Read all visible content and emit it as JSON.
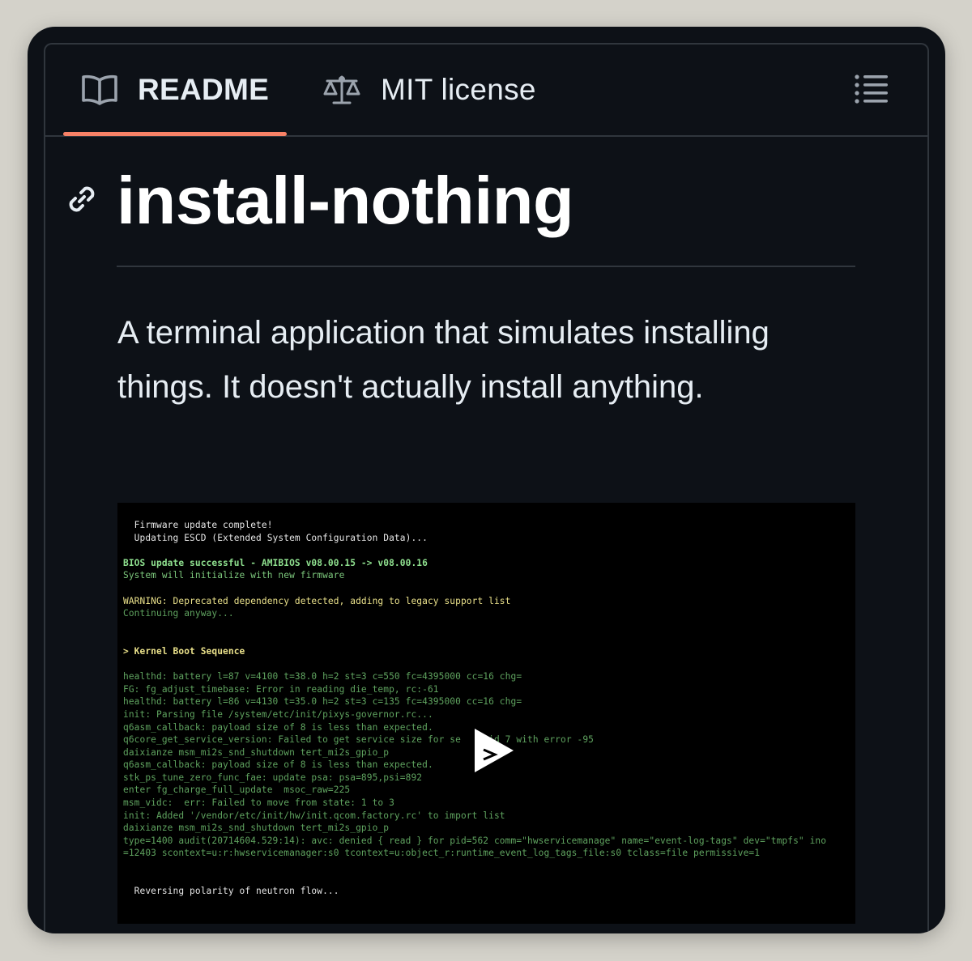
{
  "tabs": [
    {
      "label": "README",
      "icon": "book-icon",
      "active": true
    },
    {
      "label": "MIT license",
      "icon": "law-scale-icon",
      "active": false
    }
  ],
  "outline_icon": "list-unordered-icon",
  "heading": {
    "text": "install-nothing",
    "anchor_icon": "link-icon"
  },
  "description": "A terminal application that simulates installing things. It doesn't actually install anything.",
  "video": {
    "play_icon": "play-icon",
    "lines": [
      {
        "text": "  Firmware update complete!",
        "style": "white"
      },
      {
        "text": "  Updating ESCD (Extended System Configuration Data)...",
        "style": "white"
      },
      {
        "text": "",
        "style": "white"
      },
      {
        "text": "BIOS update successful - AMIBIOS v08.00.15 -> v08.00.16",
        "style": "green-b"
      },
      {
        "text": "System will initialize with new firmware",
        "style": "green"
      },
      {
        "text": "",
        "style": "white"
      },
      {
        "text": "WARNING: Deprecated dependency detected, adding to legacy support list",
        "style": "yellow"
      },
      {
        "text": "Continuing anyway...",
        "style": "dim"
      },
      {
        "text": "",
        "style": "white"
      },
      {
        "text": "",
        "style": "white"
      },
      {
        "text": "> Kernel Boot Sequence",
        "style": "yellow-b"
      },
      {
        "text": "",
        "style": "white"
      },
      {
        "text": "healthd: battery l=87 v=4100 t=38.0 h=2 st=3 c=550 fc=4395000 cc=16 chg=",
        "style": "dim"
      },
      {
        "text": "FG: fg_adjust_timebase: Error in reading die_temp, rc:-61",
        "style": "dim"
      },
      {
        "text": "healthd: battery l=86 v=4130 t=35.0 h=2 st=3 c=135 fc=4395000 cc=16 chg=",
        "style": "dim"
      },
      {
        "text": "init: Parsing file /system/etc/init/pixys-governor.rc...",
        "style": "dim"
      },
      {
        "text": "q6asm_callback: payload size of 8 is less than expected.",
        "style": "dim"
      },
      {
        "text": "q6core_get_service_version: Failed to get service size for se     id 7 with error -95",
        "style": "dim"
      },
      {
        "text": "daixianze msm_mi2s_snd_shutdown tert_mi2s_gpio_p",
        "style": "dim"
      },
      {
        "text": "q6asm_callback: payload size of 8 is less than expected.",
        "style": "dim"
      },
      {
        "text": "stk_ps_tune_zero_func_fae: update psa: psa=895,psi=892",
        "style": "dim"
      },
      {
        "text": "enter fg_charge_full_update  msoc_raw=225",
        "style": "dim"
      },
      {
        "text": "msm_vidc:  err: Failed to move from state: 1 to 3",
        "style": "dim"
      },
      {
        "text": "init: Added '/vendor/etc/init/hw/init.qcom.factory.rc' to import list",
        "style": "dim"
      },
      {
        "text": "daixianze msm_mi2s_snd_shutdown tert_mi2s_gpio_p",
        "style": "dim"
      },
      {
        "text": "type=1400 audit(20714604.529:14): avc: denied { read } for pid=562 comm=\"hwservicemanage\" name=\"event-log-tags\" dev=\"tmpfs\" ino",
        "style": "dim"
      },
      {
        "text": "=12403 scontext=u:r:hwservicemanager:s0 tcontext=u:object_r:runtime_event_log_tags_file:s0 tclass=file permissive=1",
        "style": "dim"
      },
      {
        "text": "",
        "style": "white"
      },
      {
        "text": "",
        "style": "white"
      },
      {
        "text": "  Reversing polarity of neutron flow...",
        "style": "white"
      }
    ]
  },
  "colors": {
    "background": "#0d1117",
    "active_tab_underline": "#f78166",
    "border": "#30363d",
    "text": "#e6edf3"
  }
}
